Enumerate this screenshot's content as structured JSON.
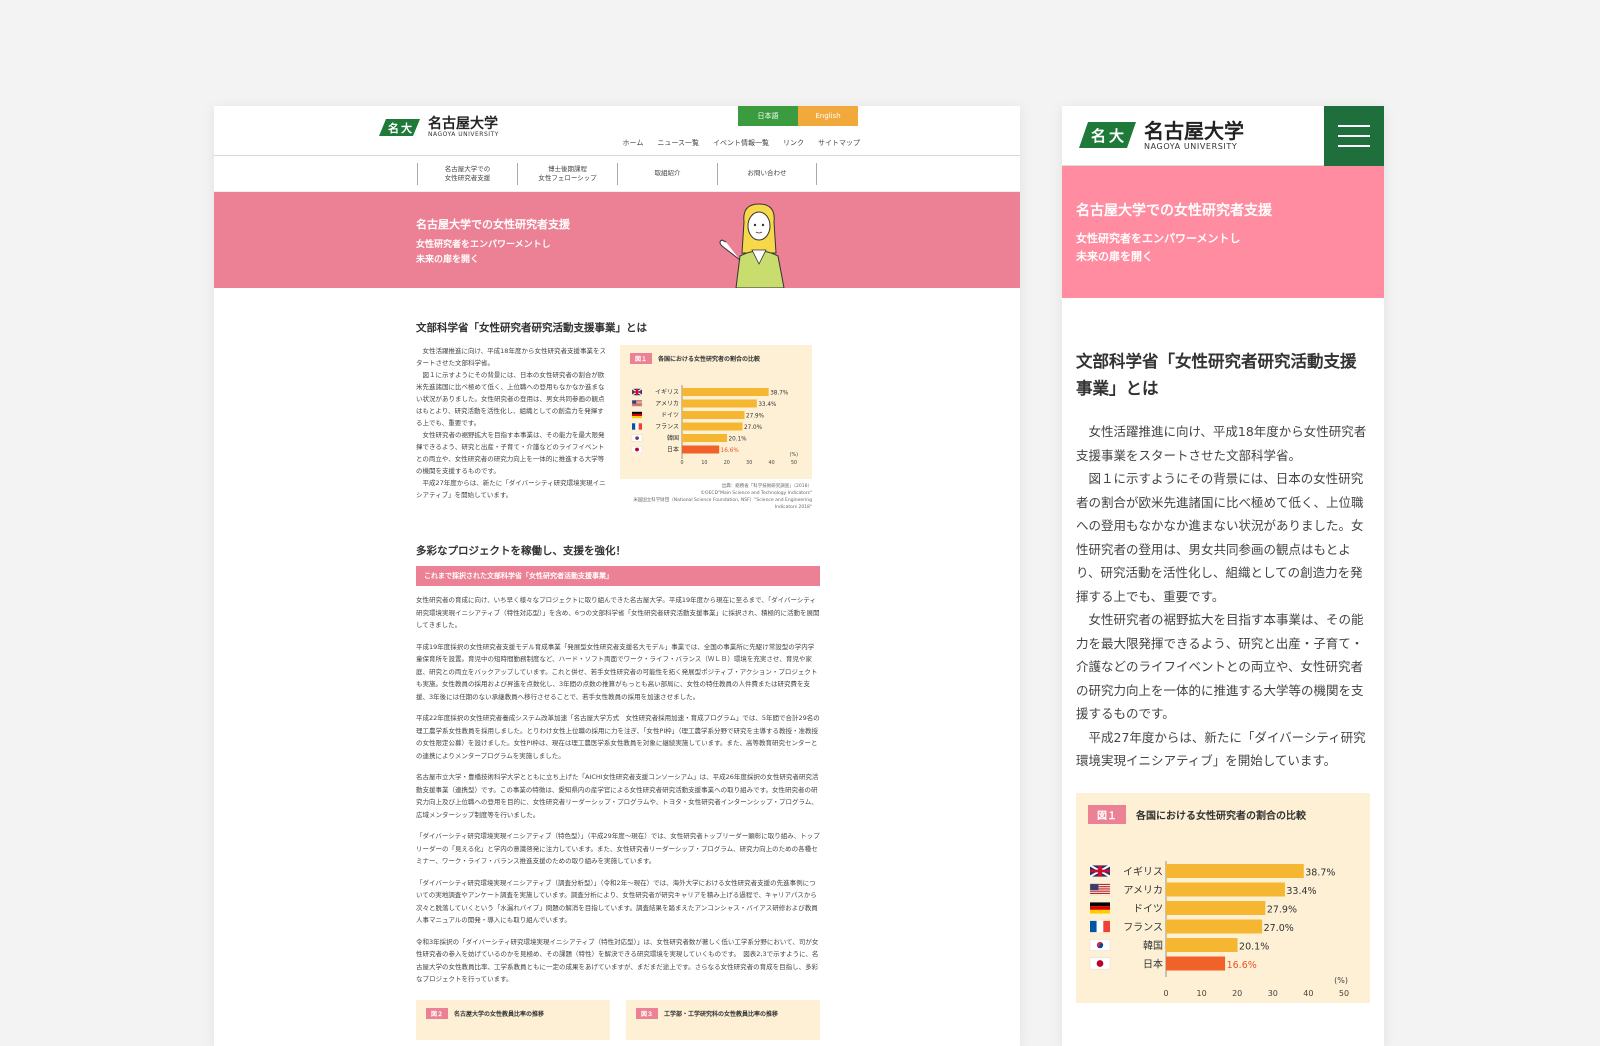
{
  "logo": {
    "ja": "名古屋大学",
    "en": "NAGOYA UNIVERSITY"
  },
  "lang": {
    "jp": "日本語",
    "en": "English"
  },
  "nav": [
    "ホーム",
    "ニュース一覧",
    "イベント情報一覧",
    "リンク",
    "サイトマップ"
  ],
  "subnav": [
    "名古屋大学での\n女性研究者支援",
    "博士後期課程\n女性フェローシップ",
    "取組紹介",
    "お問い合わせ"
  ],
  "hero": {
    "title": "名古屋大学での女性研究者支援",
    "tagline": "女性研究者をエンパワーメントし\n未来の扉を開く"
  },
  "section1": {
    "heading": "文部科学省「女性研究者研究活動支援事業」とは",
    "heading_mobile": "文部科学省「女性研究者研究活動支援事業」とは",
    "paragraphs": [
      "女性活躍推進に向け、平成18年度から女性研究者支援事業をスタートさせた文部科学省。",
      "図１に示すようにその背景には、日本の女性研究者の割合が欧米先進諸国に比べ極めて低く、上位職への登用もなかなか進まない状況がありました。女性研究者の登用は、男女共同参画の観点はもとより、研究活動を活性化し、組織としての創造力を発揮する上でも、重要です。",
      "女性研究者の裾野拡大を目指す本事業は、その能力を最大限発揮できるよう、研究と出産・子育て・介護などのライフイベントとの両立や、女性研究者の研究力向上を一体的に推進する大学等の機関を支援するものです。",
      "平成27年度からは、新たに「ダイバーシティ研究環境実現イニシアティブ」を開始しています。"
    ]
  },
  "figure1": {
    "tag": "図１",
    "title": "各国における女性研究者の割合の比較",
    "source": "出典：総務省「科学技術研究調査」（2018）\n©OECD\"Main Science and Technology Indicators\"\n米国国立科学財団（National Science Foundation, NSF）\"Science and Engineering Indicators 2018\""
  },
  "chart_data": {
    "type": "bar",
    "orientation": "horizontal",
    "title": "各国における女性研究者の割合の比較",
    "categories": [
      "イギリス",
      "アメリカ",
      "ドイツ",
      "フランス",
      "韓国",
      "日本"
    ],
    "values": [
      38.7,
      33.4,
      27.9,
      27.0,
      20.1,
      16.6
    ],
    "value_labels": [
      "38.7%",
      "33.4%",
      "27.9%",
      "27.0%",
      "20.1%",
      "16.6%"
    ],
    "xticks": [
      "0",
      "10",
      "20",
      "30",
      "40",
      "50"
    ],
    "xlim": [
      0,
      50
    ],
    "unit": "(%)",
    "colors": {
      "default": "#f5b731",
      "highlight": "#f0622a",
      "label_highlight": "#e8542a",
      "background": "#fdf0d5"
    }
  },
  "section2": {
    "heading": "多彩なプロジェクトを稼働し、支援を強化！",
    "bar": "これまで採択された文部科学省「女性研究者活動支援事業」",
    "paragraphs": [
      "女性研究者の育成に向け、いち早く様々なプロジェクトに取り組んできた名古屋大学。平成19年度から現在に至るまで、「ダイバーシティ研究環境実現イニシアティブ（特性対応型）」を含め、6つの文部科学省「女性研究者研究活動支援事業」に採択され、積極的に活動を展開してきました。",
      "平成19年度採択の女性研究者支援モデル育成事業「発展型女性研究者支援名大モデル」事業では、全国の事業所に先駆け常設型の学内学童保育所を設置。育児中の短時間勤務制度など、ハード・ソフト両面でワーク・ライフ・バランス（ＷＬＢ）環境を充実させ、育児や家庭、研究との両立をバックアップしています。これと併せ、若手女性研究者の可能性を拓く発展型ポジティブ・アクション・プロジェクトも実施。女性教員の採用および昇進を点数化し、3年間の点数の推算がもっとも高い部局に、女性の特任教員の人件費または研究費を支援、3年後には任期のない承継教員へ移行させることで、若手女性教員の採用を加速させました。",
      "平成22年度採択の女性研究者養成システム改革加速「名古屋大学方式　女性研究者採用加速・育成プログラム」では、5年間で合計29名の理工農学系女性教員を採用しました。とりわけ女性上位職の採用に力を注ぎ、「女性PI枠」（理工農学系分野で研究を主導する教授・准教授の女性限定公募）を設けました。女性PI枠は、現在は理工農医学系女性教員を対象に継続実施しています。また、高等教育研究センターとの連携によりメンタープログラムを実施しました。",
      "名古屋市立大学・豊橋技術科学大学とともに立ち上げた「AICHI女性研究者支援コンソーシアム」は、平成26年度採択の女性研究者研究活動支援事業（連携型）です。この事業の特徴は、愛知県内の産学官による女性研究者研究活動支援事業への取り組みです。女性研究者の研究力向上及び上位職への登用を目的に、女性研究者リーダーシップ・プログラムや、トヨタ・女性研究者インターンシップ・プログラム、広域メンターシップ制度等を行いました。",
      "「ダイバーシティ研究環境実現イニシアティブ（特色型）」（平成29年度〜現在）では、女性研究者トップリーダー顕彰に取り組み、トップリーダーの「見える化」と学内の意識啓発に注力しています。また、女性研究者リーダーシップ・プログラム、研究力向上のための各種セミナー、ワーク・ライフ・バランス推進支援のための取り組みを実施しています。",
      "「ダイバーシティ研究環境実現イニシアティブ（調査分析型）」（令和2年〜現在）では、海外大学における女性研究者支援の先進事例についての実地調査やアンケート調査を実施しています。調査分析により、女性研究者が研究キャリアを積み上げる過程で、キャリアパスから次々と脱落していくという「水漏れパイプ」問題の解消を目指しています。調査結果を踏まえたアンコンシャス・バイアス研修および教員人事マニュアルの開発・導入にも取り組んでいます。",
      "令和3年採択の「ダイバーシティ研究環境実現イニシアティブ（特性対応型）」は、女性研究者数が著しく低い工学系分野において、司が女性研究者の参入を妨げているのかを見極め、その課題（特性）を解決できる研究環境を実現していくものです。　図表2,3で示すように、名古屋大学の女性教員比率、工学系教員ともに一定の成果をあげていますが、まだまだ途上です。さらなる女性研究者の育成を目指し、多彩なプロジェクトを行っています。"
    ]
  },
  "figure2": {
    "tag": "図２",
    "title": "名古屋大学の女性教員比率の推移"
  },
  "figure3": {
    "tag": "図３",
    "title": "工学部・工学研究科の女性教員比率の推移"
  }
}
